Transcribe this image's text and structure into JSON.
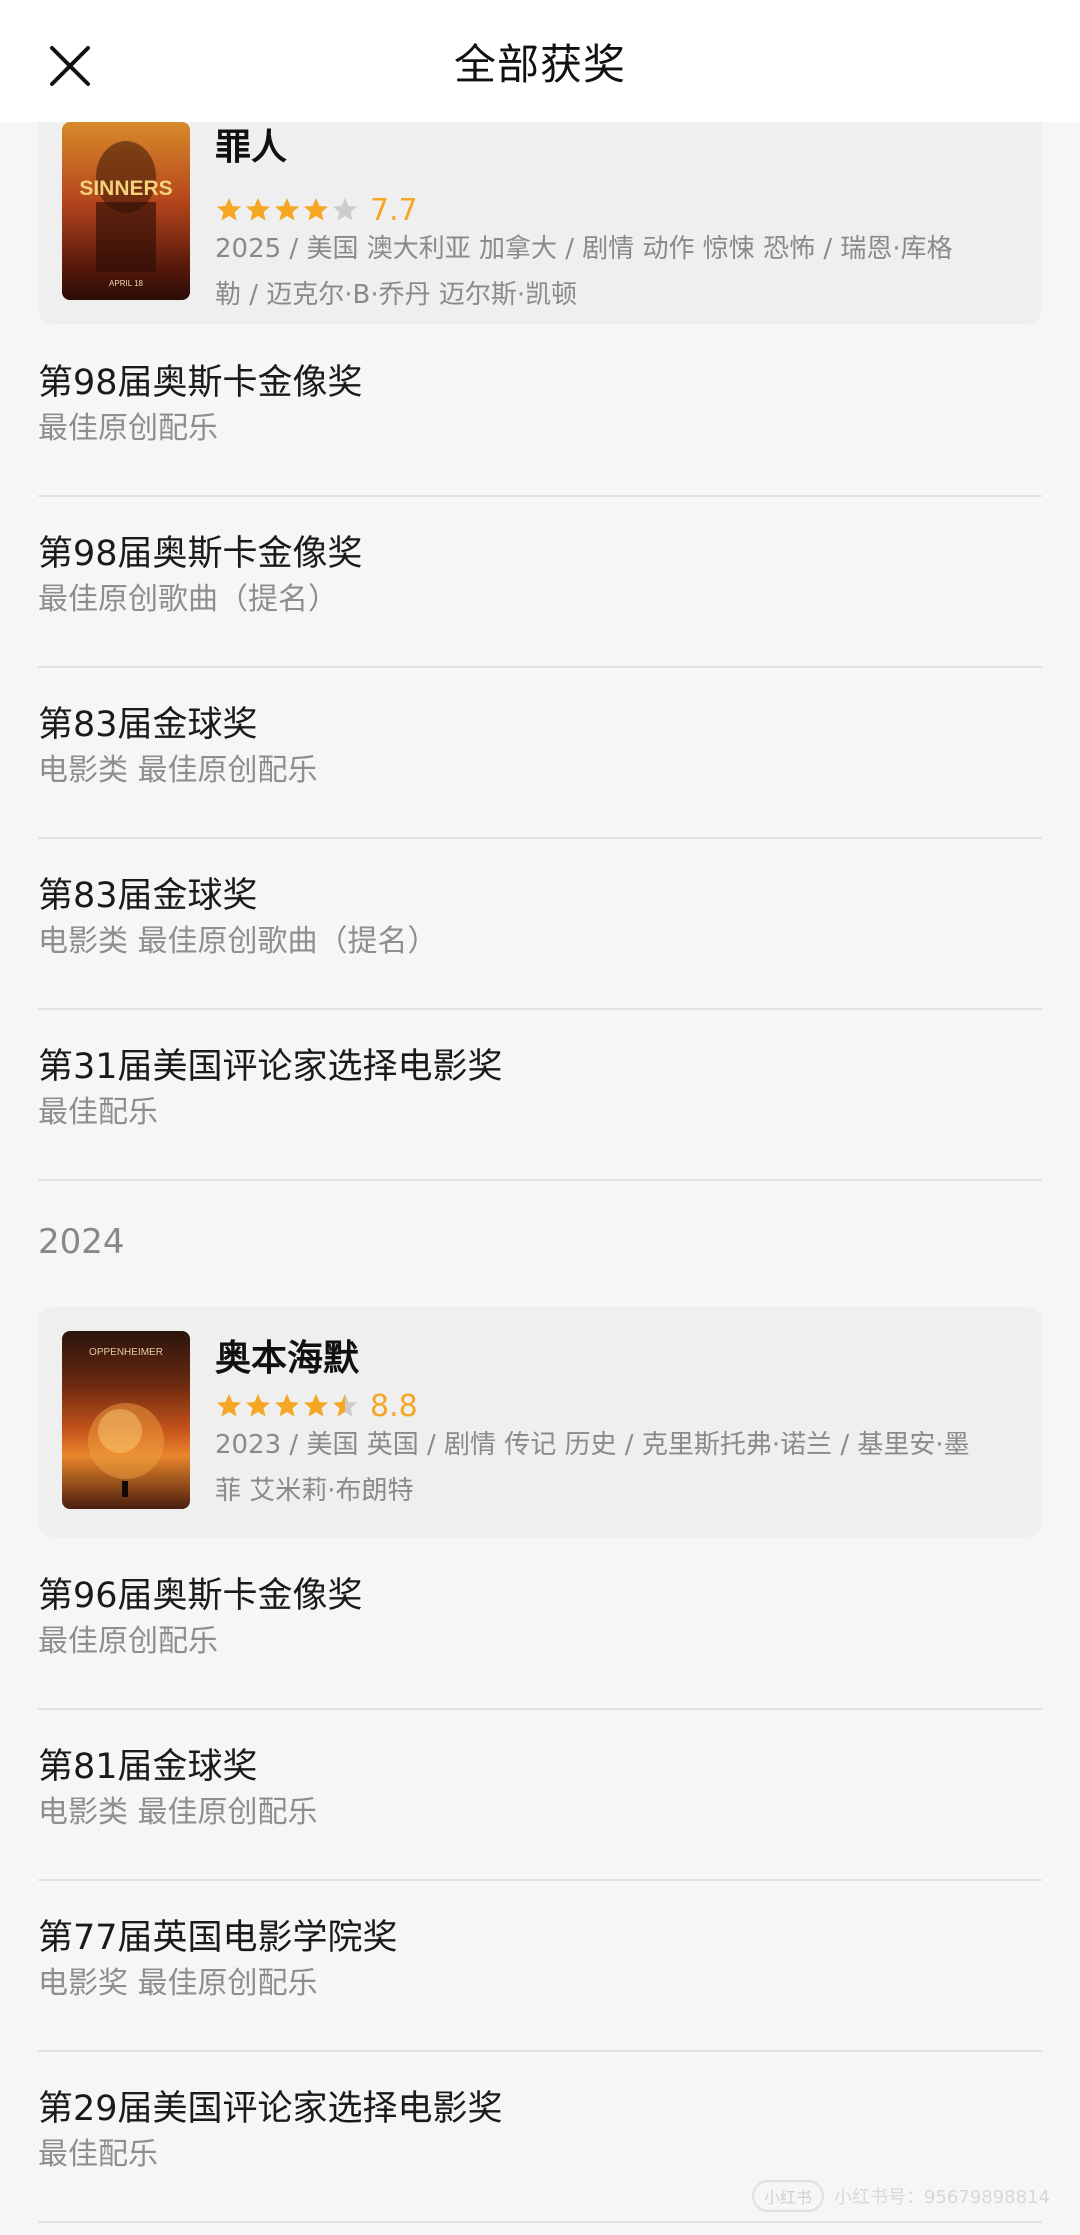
{
  "header": {
    "title": "全部获奖"
  },
  "films": [
    {
      "title": "罪人",
      "rating": "7.7",
      "stars": [
        1,
        1,
        1,
        1,
        0
      ],
      "meta_line1": "2025 / 美国 澳大利亚 加拿大 / 剧情 动作 惊悚 恐怖 / 瑞恩·库格",
      "meta_line2": "勒 / 迈克尔·B·乔丹 迈尔斯·凯顿",
      "poster_text": "SINNERS",
      "poster_subtext": "APRIL 18",
      "awards": [
        {
          "name": "第98届奥斯卡金像奖",
          "category": "最佳原创配乐"
        },
        {
          "name": "第98届奥斯卡金像奖",
          "category": "最佳原创歌曲（提名）"
        },
        {
          "name": "第83届金球奖",
          "category": "电影类 最佳原创配乐"
        },
        {
          "name": "第83届金球奖",
          "category": "电影类 最佳原创歌曲（提名）"
        },
        {
          "name": "第31届美国评论家选择电影奖",
          "category": "最佳配乐"
        }
      ]
    },
    {
      "year": "2024",
      "title": "奥本海默",
      "rating": "8.8",
      "stars": [
        1,
        1,
        1,
        1,
        0.5
      ],
      "meta_line1": "2023 / 美国 英国 / 剧情 传记 历史 / 克里斯托弗·诺兰 / 基里安·墨",
      "meta_line2": "菲 艾米莉·布朗特",
      "poster_text": "OPPENHEIMER",
      "awards": [
        {
          "name": "第96届奥斯卡金像奖",
          "category": "最佳原创配乐"
        },
        {
          "name": "第81届金球奖",
          "category": "电影类 最佳原创配乐"
        },
        {
          "name": "第77届英国电影学院奖",
          "category": "电影奖 最佳原创配乐"
        },
        {
          "name": "第29届美国评论家选择电影奖",
          "category": "最佳配乐"
        }
      ]
    }
  ],
  "watermark": {
    "badge": "小红书",
    "text": "小红书号：95679898814"
  },
  "colors": {
    "star": "#f5a623",
    "star_empty": "#cccccc",
    "card_bg": "#efefef"
  },
  "icons": {
    "close": "close-icon",
    "star": "star-icon"
  }
}
